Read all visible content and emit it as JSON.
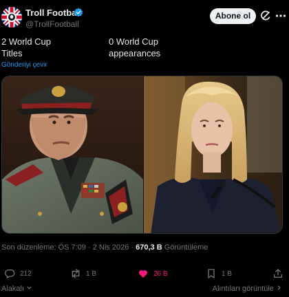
{
  "author": {
    "display_name": "Troll Football",
    "handle": "@TrollFootball",
    "verified": true,
    "avatar_icon": "uk-flag-avatar"
  },
  "header": {
    "follow_label": "Abone ol",
    "grok_icon": "grok-icon",
    "more_icon": "more-icon"
  },
  "tweet": {
    "left_line1": "2 World Cup",
    "left_line2": "Titles",
    "right_line1": "0 World Cup",
    "right_line2": "appearances",
    "translate_label": "Gönderiyi çevir"
  },
  "meta": {
    "edited_label": "Son düzenleme:",
    "time": "ÖS 7:09",
    "separator": "·",
    "date": "2 Nis 2026",
    "views_count": "670,3 B",
    "views_label": "Görüntüleme"
  },
  "actions": {
    "replies": "212",
    "retweets": "1 B",
    "likes": "26 B",
    "bookmarks": "1 B"
  },
  "footer": {
    "language_label": "Alakalı",
    "translations_label": "Alıntıları görüntüle"
  },
  "colors": {
    "background": "#000000",
    "text": "#e7e9ea",
    "muted": "#71767b",
    "link": "#1d9bf0",
    "like": "#f91880",
    "verified": "#1d9bf0"
  }
}
